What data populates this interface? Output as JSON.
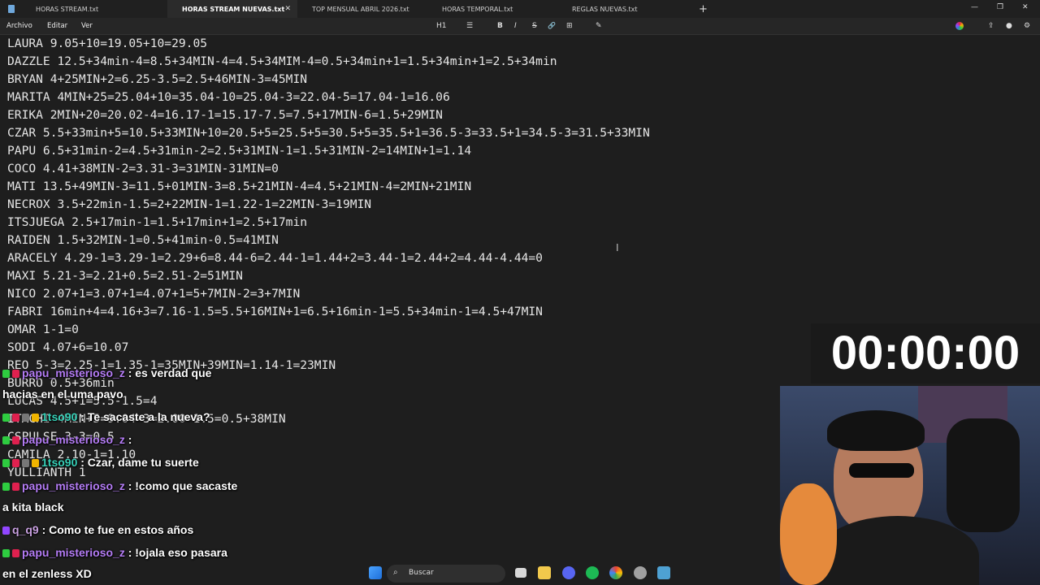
{
  "tabs": [
    {
      "label": "HORAS STREAM.txt",
      "active": false
    },
    {
      "label": "HORAS STREAM NUEVAS.txt",
      "active": true
    },
    {
      "label": "TOP MENSUAL ABRIL 2026.txt",
      "active": false
    },
    {
      "label": "HORAS TEMPORAL.txt",
      "active": false
    },
    {
      "label": "REGLAS NUEVAS.txt",
      "active": false
    }
  ],
  "window": {
    "close_tab": "✕",
    "new_tab": "+",
    "minimize": "—",
    "maximize": "❐",
    "close": "✕"
  },
  "menu": {
    "file": "Archivo",
    "edit": "Editar",
    "view": "Ver"
  },
  "format_toolbar": {
    "heading": "H1",
    "list": "☰",
    "bold": "B",
    "italic": "I",
    "strike": "S",
    "link": "🔗",
    "table": "⊞",
    "clear": "✎"
  },
  "editor_lines": [
    "LAURA 9.05+10=19.05+10=29.05",
    "DAZZLE 12.5+34min-4=8.5+34MIN-4=4.5+34MIM-4=0.5+34min+1=1.5+34min+1=2.5+34min",
    "BRYAN 4+25MIN+2=6.25-3.5=2.5+46MIN-3=45MIN",
    "MARITA 4MIN+25=25.04+10=35.04-10=25.04-3=22.04-5=17.04-1=16.06",
    "ERIKA 2MIN+20=20.02-4=16.17-1=15.17-7.5=7.5+17MIN-6=1.5+29MIN",
    "CZAR 5.5+33min+5=10.5+33MIN+10=20.5+5=25.5+5=30.5+5=35.5+1=36.5-3=33.5+1=34.5-3=31.5+33MIN",
    "PAPU 6.5+31min-2=4.5+31min-2=2.5+31MIN-1=1.5+31MIN-2=14MIN+1=1.14",
    "COCO 4.41+38MIN-2=3.31-3=31MIN-31MIN=0",
    "MATI 13.5+49MIN-3=11.5+01MIN-3=8.5+21MIN-4=4.5+21MIN-4=2MIN+21MIN",
    "NECROX 3.5+22min-1.5=2+22MIN-1=1.22-1=22MIN-3=19MIN",
    "ITSJUEGA 2.5+17min-1=1.5+17min+1=2.5+17min",
    "RAIDEN 1.5+32MIN-1=0.5+41min-0.5=41MIN",
    "ARACELY 4.29-1=3.29-1=2.29+6=8.44-6=2.44-1=1.44+2=3.44-1=2.44+2=4.44-4.44=0",
    "MAXI 5.21-3=2.21+0.5=2.51-2=51MIN",
    "NICO 2.07+1=3.07+1=4.07+1=5+7MIN-2=3+7MIN",
    "FABRI 16min+4=4.16+3=7.16-1.5=5.5+16MIN+1=6.5+16min-1=5.5+34min-1=4.5+47MIN",
    "OMAR 1-1=0",
    "SODI 4.07+6=10.07",
    "REO 5-3=2.25-1=1.35-1=35MIN+39MIN=1.14-1=23MIN",
    "BURRO 0.5+36min",
    "LUCAS 4.5+1=5.5-1.5=4",
    "ITACHI 4MIN+5=9.04-3=2.00-1.5=0.5+38MIN",
    "CSPULSE 3-3=0.5",
    "CAMILA 2.10-1=1.10",
    "YULLIANTH 1"
  ],
  "timer": "00:00:00",
  "chat": [
    {
      "user": "papu_misterioso_z",
      "message": ": es verdad que",
      "style": "p",
      "badges": [
        "#2ecc40",
        "#e0204f"
      ]
    },
    {
      "user": "",
      "message": "hacias en el uma pavo",
      "style": "plain",
      "badges": []
    },
    {
      "user": "1tso90",
      "message": ": Te sacaste a la nueva?",
      "style": "t",
      "badges": [
        "#2ecc40",
        "#e0204f",
        "#777777",
        "#f0b400"
      ]
    },
    {
      "user": "papu_misterioso_z",
      "message": ":",
      "style": "p",
      "badges": [
        "#2ecc40",
        "#e0204f"
      ]
    },
    {
      "user": "1tso90",
      "message": ": Czar, dame tu suerte",
      "style": "t",
      "badges": [
        "#2ecc40",
        "#e0204f",
        "#777777",
        "#f0b400"
      ]
    },
    {
      "user": "papu_misterioso_z",
      "message": ": !como que sacaste",
      "style": "p",
      "badges": [
        "#2ecc40",
        "#e0204f"
      ]
    },
    {
      "user": "",
      "message": "a kita black",
      "style": "plain",
      "badges": []
    },
    {
      "user": "q_q9",
      "message": ": Como te fue en estos años",
      "style": "g",
      "badges": [
        "#9146ff"
      ]
    },
    {
      "user": "papu_misterioso_z",
      "message": ": !ojala eso pasara",
      "style": "p",
      "badges": [
        "#2ecc40",
        "#e0204f"
      ]
    },
    {
      "user": "",
      "message": "en el zenless XD",
      "style": "plain",
      "badges": []
    }
  ],
  "taskbar": {
    "search_placeholder": "Buscar"
  },
  "colors": {
    "editor_bg": "#1e1e1e",
    "timer_bg": "#1a1a1a",
    "accent": "#e0204f"
  }
}
